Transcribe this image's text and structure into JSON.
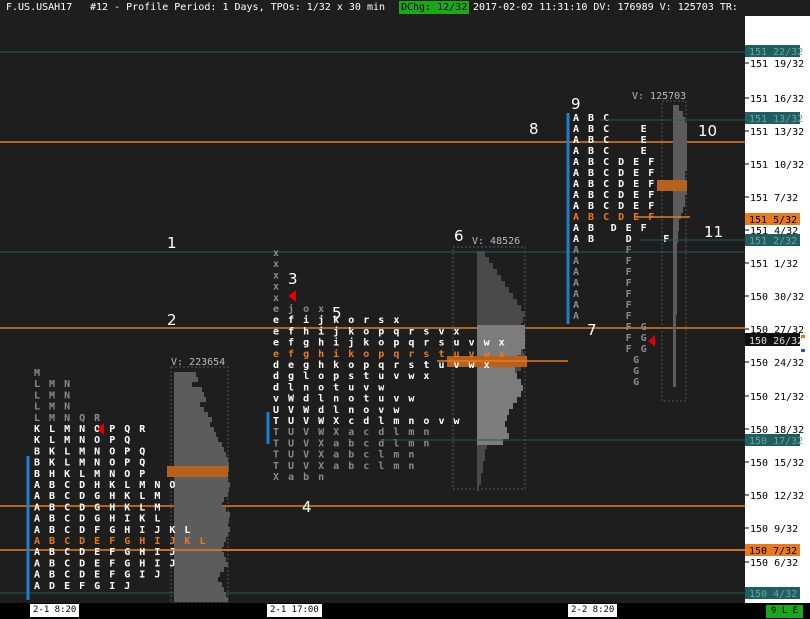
{
  "header": {
    "symbol": "F.US.USAH17",
    "description": "#12 - Profile Period: 1 Days, TPOs: 1/32 x 30 min",
    "dchg": "DChg: 12/32",
    "info": "2017-02-02 11:31:10 DV: 176989 V: 125703 TR:"
  },
  "price_axis": {
    "ticks": [
      "151 19/32",
      "151 16/32",
      "151 13/32",
      "151 10/32",
      "151 7/32",
      "151 4/32",
      "151 1/32",
      "150 30/32",
      "150 27/32",
      "150 24/32",
      "150 21/32",
      "150 18/32",
      "150 15/32",
      "150 12/32",
      "150 9/32",
      "150 6/32"
    ],
    "faded_labels": [
      "151 22/32",
      "151 13/32",
      "151 2/32",
      "150 17/32",
      "150 4/32"
    ],
    "highlight_labels": [
      "151 5/32",
      "150 7/32"
    ],
    "current_label": "150 26/32",
    "colors": {
      "orange": "#e87a1e",
      "teal": "#1f5f5f",
      "current": "#000000"
    }
  },
  "time_axis": {
    "labels": [
      "2-1  8:20",
      "2-1  17:00",
      "2-2  8:20"
    ]
  },
  "status": "9 L E",
  "annotations": [
    "1",
    "2",
    "3",
    "4",
    "5",
    "6",
    "7",
    "8",
    "9",
    "10",
    "11"
  ],
  "profiles": [
    {
      "volume": "V: 223654",
      "rows": [
        "M",
        "LMN",
        "LMN",
        "LMN",
        "LMNQR",
        "KLMNOPQR",
        "KLMNOPQ",
        "BKLMNOPQ",
        "BKLMNOPQ",
        "BHKLMNOP",
        "ABCDHKLMNO",
        "ABCDGHKLM",
        "ABCDGHKLM",
        "ABCDGHIKL",
        "ABCDFGHIJKL",
        "ABCDEFGHIJKL",
        "ABCDEFGHIJ",
        "ABCDEFGHIJ",
        "ABCDEFGIJ",
        "ADEFGIJ"
      ]
    },
    {
      "volume": "",
      "rows": [
        "x",
        "x",
        "x",
        "x",
        "x",
        "ejox",
        "efijkorsx",
        "efhijkopqrsvx",
        "efghijkopqrsuvwx",
        "efghikopqrstuvwx",
        "deghkopqrstuvwx",
        "dglopstuvwx",
        "dlnotuvw",
        "vWdlnotuvw",
        "UVWdlnovw",
        "TUVWXcdlmnovw",
        "TUVWXacdlmn",
        "TUVXabcdlmn",
        "TUVXabclmn",
        "TUVXabclmn",
        "Xabn"
      ]
    },
    {
      "volume": "V: 48526",
      "rows": []
    },
    {
      "volume": "V: 125703",
      "rows": [
        "ABC",
        "ABC  E",
        "ABC  E",
        "ABC  E",
        "ABCDEF",
        "ABCDEF",
        "ABCDEF",
        "ABCDEF",
        "ABCDEF",
        "ABCDEF",
        "AB DEF",
        "AB  D  F",
        "A    F",
        "A    F",
        "A    F",
        "A    F",
        "A    F",
        "A    F",
        "A    F",
        "     FG",
        "     FG",
        "     FG",
        "      G",
        "      G",
        "      G"
      ]
    }
  ]
}
